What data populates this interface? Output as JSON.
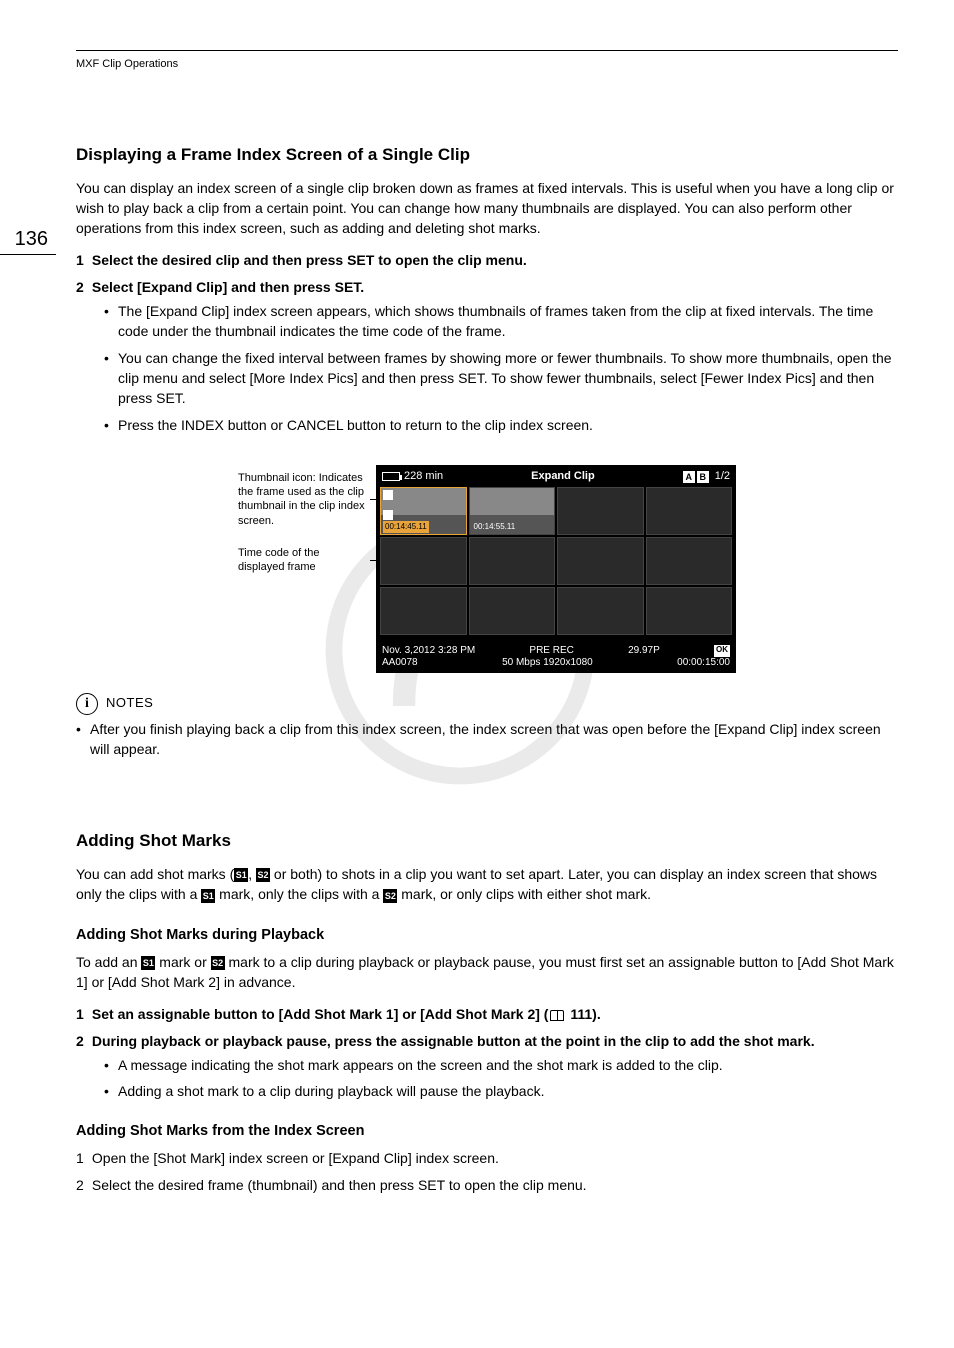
{
  "header": "MXF Clip Operations",
  "pageNumber": "136",
  "section1": {
    "title": "Displaying a Frame Index Screen of a Single Clip",
    "intro": "You can display an index screen of a single clip broken down as frames at fixed intervals. This is useful when you have a long clip or wish to play back a clip from a certain point. You can change how many thumbnails are displayed. You can also perform other operations from this index screen, such as adding and deleting shot marks.",
    "step1": "Select the desired clip and then press SET to open the clip menu.",
    "step2": "Select [Expand Clip] and then press SET.",
    "bullets": [
      "The [Expand Clip] index screen appears, which shows thumbnails of frames taken from the clip at fixed intervals. The time code under the thumbnail indicates the time code of the frame.",
      "You can change the fixed interval between frames by showing more or fewer thumbnails. To show more thumbnails, open the clip menu and select [More Index Pics] and then press SET. To show fewer thumbnails, select [Fewer Index Pics] and then press SET.",
      "Press the INDEX button or CANCEL button to return to the clip index screen."
    ]
  },
  "figure": {
    "callout1": "Thumbnail icon: Indicates the frame used as the clip thumbnail in the clip index screen.",
    "callout2": "Time code of the displayed frame",
    "topBattery": "228 min",
    "topTitle": "Expand Clip",
    "topPage": "1/2",
    "abA": "A",
    "abB": "B",
    "tc1": "00:14:45.11",
    "tc2": "00:14:55.11",
    "bottomDate": "Nov.  3,2012  3:28 PM",
    "bottomPreRec": "PRE REC",
    "bottomFps": "29.97P",
    "bottomClip": "AA0078",
    "bottomFormat": "50 Mbps 1920x1080",
    "bottomTc": "00:00:15:00",
    "ok": "OK"
  },
  "notes": {
    "label": "NOTES",
    "item": "After you finish playing back a clip from this index screen, the index screen that was open before the [Expand Clip] index screen will appear."
  },
  "section2": {
    "title": "Adding Shot Marks",
    "intro_a": "You can add shot marks (",
    "intro_b": ", ",
    "intro_c": " or both) to shots in a clip you want to set apart. Later, you can display an index screen that shows only the clips with a ",
    "intro_d": " mark, only the clips with a ",
    "intro_e": " mark, or only clips with either shot mark.",
    "sub1": {
      "title": "Adding Shot Marks during Playback",
      "intro_a": "To add an ",
      "intro_b": " mark or ",
      "intro_c": " mark to a clip during playback or playback pause, you must first set an assignable button to [Add Shot Mark 1] or [Add Shot Mark 2] in advance.",
      "step1_a": "Set an assignable button to [Add Shot Mark 1] or [Add Shot Mark 2] (",
      "step1_b": " 111).",
      "step2": "During playback or playback pause, press the assignable button at the point in the clip to add the shot mark.",
      "bullets": [
        "A message indicating the shot mark appears on the screen and the shot mark is added to the clip.",
        "Adding a shot mark to a clip during playback will pause the playback."
      ]
    },
    "sub2": {
      "title": "Adding Shot Marks from the Index Screen",
      "step1": "Open the [Shot Mark] index screen or [Expand Clip] index screen.",
      "step2": "Select the desired frame (thumbnail) and then press SET to open the clip menu."
    }
  },
  "marks": {
    "s1": "S1",
    "s2": "S2"
  }
}
